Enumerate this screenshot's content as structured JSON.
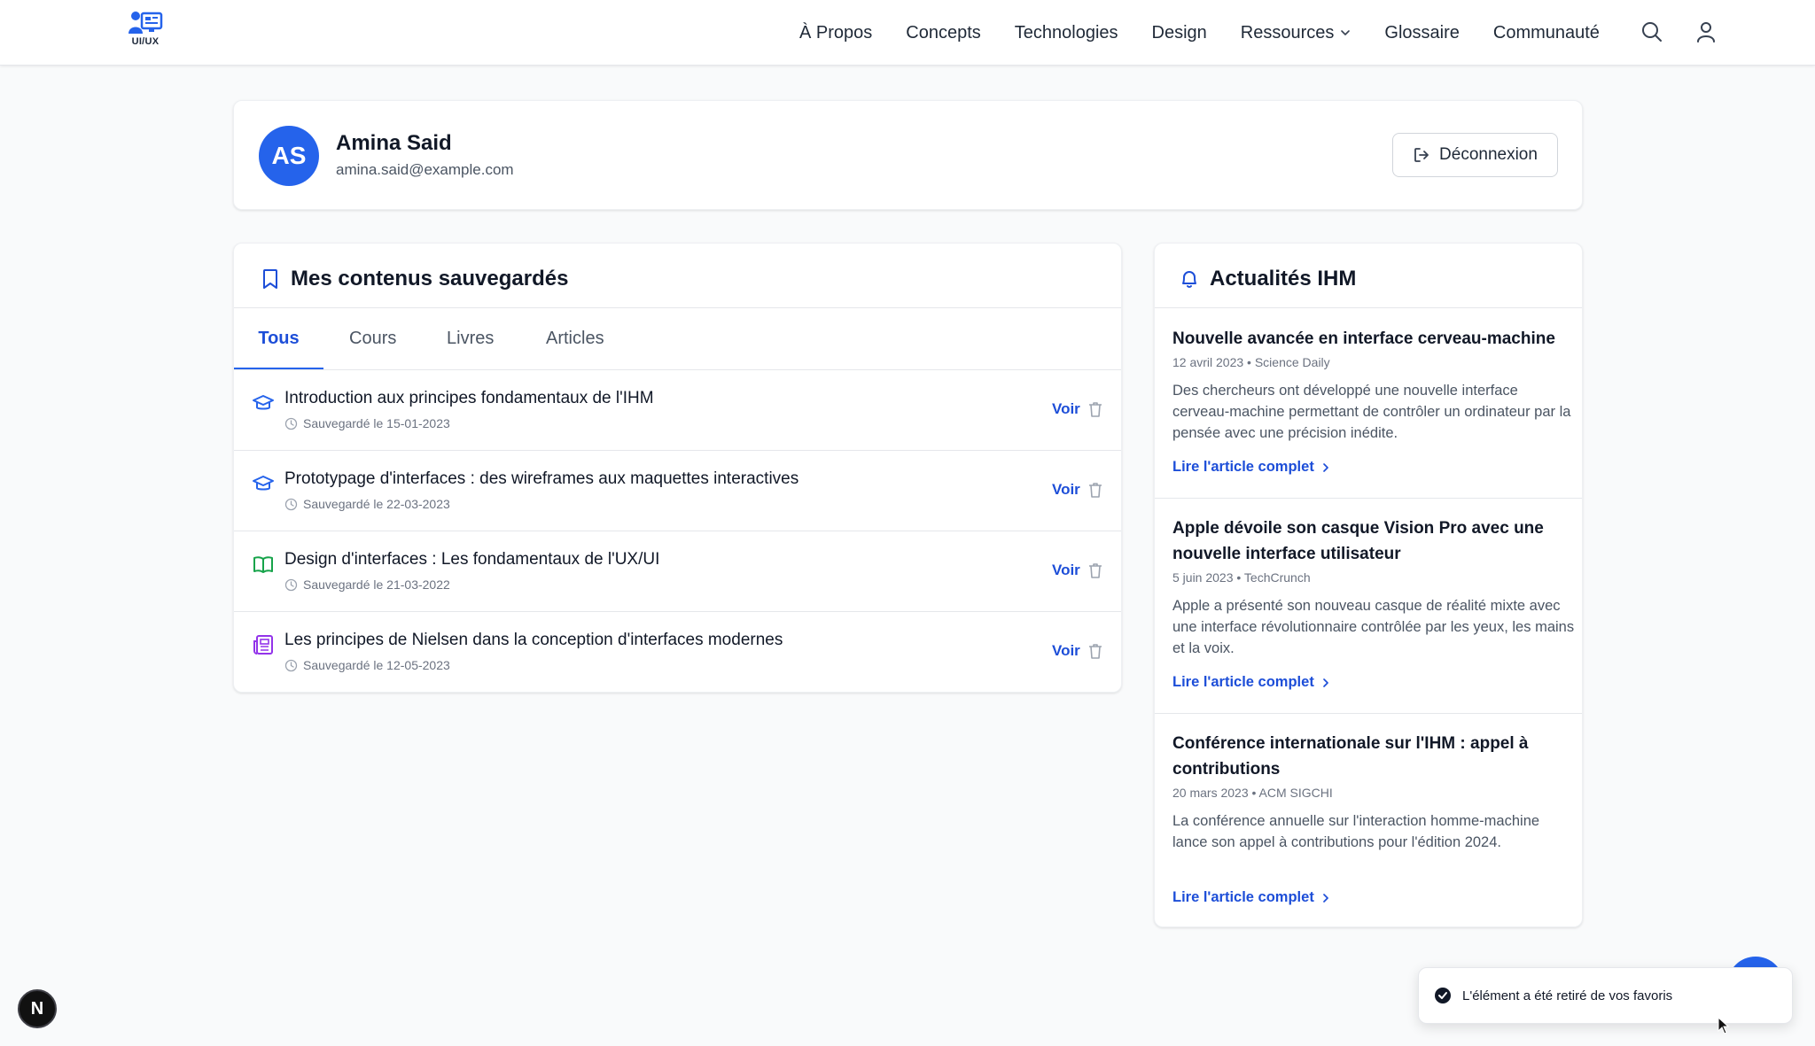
{
  "header": {
    "logo_text": "UI/UX",
    "nav": [
      {
        "label": "À Propos"
      },
      {
        "label": "Concepts"
      },
      {
        "label": "Technologies"
      },
      {
        "label": "Design"
      },
      {
        "label": "Ressources",
        "has_dropdown": true
      },
      {
        "label": "Glossaire"
      },
      {
        "label": "Communauté"
      }
    ],
    "icons": [
      "search-icon",
      "user-icon"
    ]
  },
  "profile": {
    "initials": "AS",
    "name": "Amina Said",
    "email": "amina.said@example.com",
    "logout_label": "Déconnexion"
  },
  "saved": {
    "title": "Mes contenus sauvegardés",
    "tabs": [
      {
        "label": "Tous",
        "active": true
      },
      {
        "label": "Cours",
        "active": false
      },
      {
        "label": "Livres",
        "active": false
      },
      {
        "label": "Articles",
        "active": false
      }
    ],
    "items": [
      {
        "icon": "graduation-cap-icon",
        "title": "Introduction aux principes fondamentaux de l'IHM",
        "date": "Sauvegardé le 15-01-2023",
        "view_label": "Voir"
      },
      {
        "icon": "graduation-cap-icon",
        "title": "Prototypage d'interfaces : des wireframes aux maquettes interactives",
        "date": "Sauvegardé le 22-03-2023",
        "view_label": "Voir"
      },
      {
        "icon": "book-open-icon",
        "title": "Design d'interfaces : Les fondamentaux de l'UX/UI",
        "date": "Sauvegardé le 21-03-2022",
        "view_label": "Voir"
      },
      {
        "icon": "newspaper-icon",
        "title": "Les principes de Nielsen dans la conception d'interfaces modernes",
        "date": "Sauvegardé le 12-05-2023",
        "view_label": "Voir"
      }
    ]
  },
  "news": {
    "title": "Actualités IHM",
    "items": [
      {
        "title": "Nouvelle avancée en interface cerveau-machine",
        "meta": "12 avril 2023 • Science Daily",
        "body": "Des chercheurs ont développé une nouvelle interface cerveau-machine permettant de contrôler un ordinateur par la pensée avec une précision inédite.",
        "link": "Lire l'article complet"
      },
      {
        "title": "Apple dévoile son casque Vision Pro avec une nouvelle interface utilisateur",
        "meta": "5 juin 2023 • TechCrunch",
        "body": "Apple a présenté son nouveau casque de réalité mixte avec une interface révolutionnaire contrôlée par les yeux, les mains et la voix.",
        "link": "Lire l'article complet"
      },
      {
        "title": "Conférence internationale sur l'IHM : appel à contributions",
        "meta": "20 mars 2023 • ACM SIGCHI",
        "body": "La conférence annuelle sur l'interaction homme-machine lance son appel à contributions pour l'édition 2024.",
        "link": "Lire l'article complet"
      }
    ]
  },
  "toast": {
    "message": "L'élément a été retiré de vos favoris"
  },
  "dev_badge": {
    "letter": "N"
  },
  "colors": {
    "accent": "#2563eb",
    "link": "#1d4ed8",
    "book_icon": "#16a34a",
    "article_icon": "#9333ea"
  }
}
